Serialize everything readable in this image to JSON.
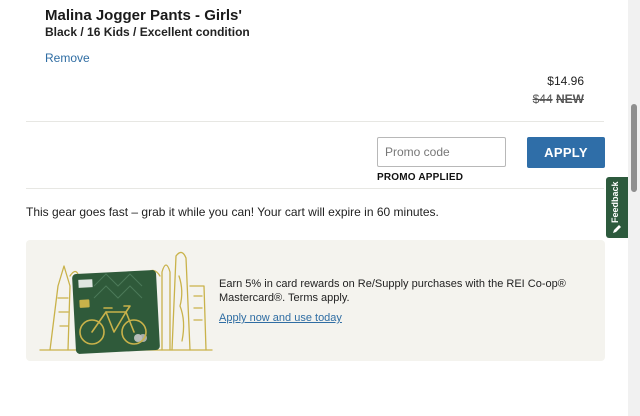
{
  "product": {
    "title": "Malina Jogger Pants - Girls'",
    "variant": "Black / 16 Kids / Excellent condition",
    "remove_label": "Remove",
    "price_current": "$14.96",
    "price_original": "$44",
    "price_original_tag": "NEW"
  },
  "promo": {
    "placeholder": "Promo code",
    "apply_label": "APPLY",
    "status": "PROMO APPLIED"
  },
  "cart_notice": "This gear goes fast – grab it while you can! Your cart will expire in 60 minutes.",
  "credit_banner": {
    "text": "Earn 5% in card rewards on Re/Supply purchases with the REI Co-op® Mastercard®. Terms apply.",
    "link_label": "Apply now and use today"
  },
  "feedback": {
    "label": "Feedback",
    "icon": "pencil-icon"
  },
  "colors": {
    "accent_blue": "#2f6ea8",
    "feedback_green": "#2d5a3d",
    "banner_bg": "#f4f3ee",
    "card_green": "#2f5a3a"
  }
}
